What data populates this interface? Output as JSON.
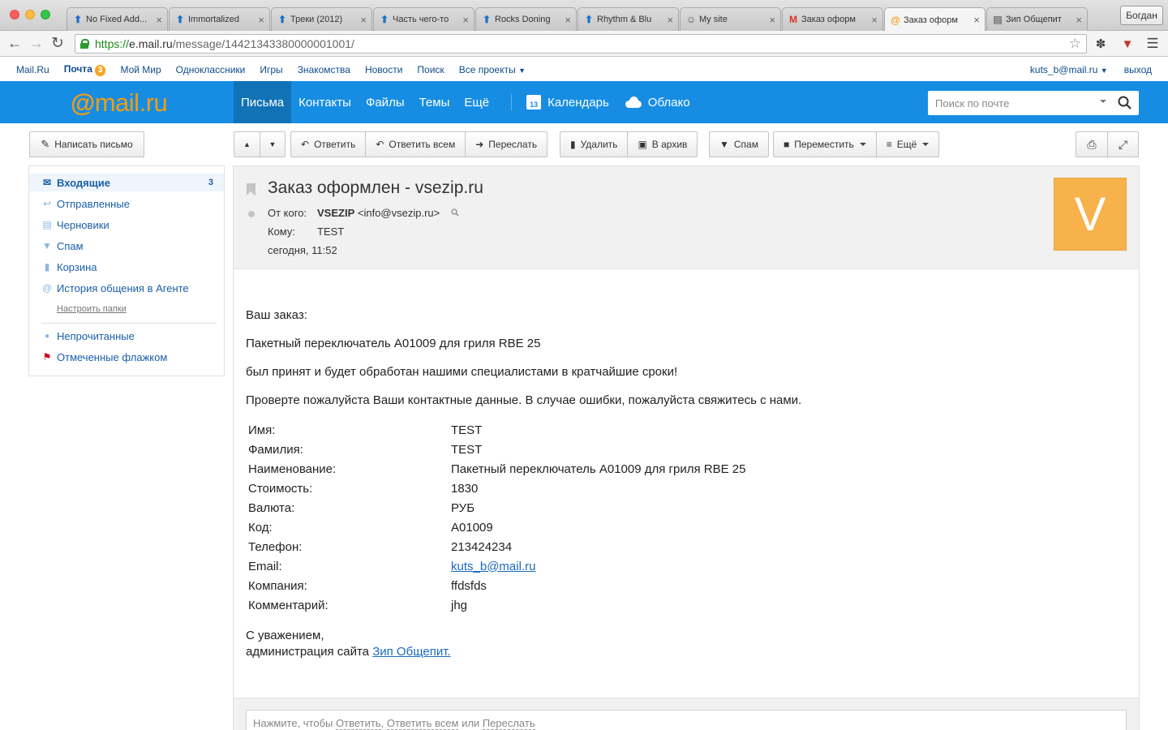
{
  "browser": {
    "tabs": [
      {
        "title": "No Fixed Add...",
        "favicon": "arrow-up-icon",
        "active": false
      },
      {
        "title": "Immortalized",
        "favicon": "arrow-up-icon",
        "active": false
      },
      {
        "title": "Треки (2012)",
        "favicon": "arrow-up-icon",
        "active": false
      },
      {
        "title": "Часть чего-то",
        "favicon": "arrow-up-icon",
        "active": false
      },
      {
        "title": "Rocks Doning",
        "favicon": "arrow-up-icon",
        "active": false
      },
      {
        "title": "Rhythm & Blu",
        "favicon": "arrow-up-icon",
        "active": false
      },
      {
        "title": "My site",
        "favicon": "ghost-icon",
        "active": false
      },
      {
        "title": "Заказ оформ",
        "favicon": "gmail-icon",
        "active": false
      },
      {
        "title": "Заказ оформ",
        "favicon": "mailru-icon",
        "active": true
      },
      {
        "title": "Зип Общепит",
        "favicon": "page-icon",
        "active": false
      }
    ],
    "profile_name": "Богдан",
    "url_scheme": "https://",
    "url_host": "e.mail.ru",
    "url_path": "/message/14421343380000001001/"
  },
  "portal": {
    "links": [
      "Mail.Ru",
      "Почта",
      "Мой Мир",
      "Одноклассники",
      "Игры",
      "Знакомства",
      "Новости",
      "Поиск",
      "Все проекты"
    ],
    "mail_badge": "3",
    "user_email": "kuts_b@mail.ru",
    "logout": "выход"
  },
  "header": {
    "logo_at": "@",
    "logo_text": "mail",
    "logo_tld": ".ru",
    "nav": [
      "Письма",
      "Контакты",
      "Файлы",
      "Темы",
      "Ещё"
    ],
    "calendar": "Календарь",
    "calendar_day": "13",
    "cloud": "Облако",
    "search_placeholder": "Поиск по почте"
  },
  "sidebar": {
    "compose": "Написать письмо",
    "folders": [
      {
        "label": "Входящие",
        "count": "3",
        "icon": "envelope-icon"
      },
      {
        "label": "Отправленные",
        "icon": "reply-icon"
      },
      {
        "label": "Черновики",
        "icon": "draft-icon"
      },
      {
        "label": "Спам",
        "icon": "thumbs-down-icon"
      },
      {
        "label": "Корзина",
        "icon": "trash-icon"
      },
      {
        "label": "История общения в Агенте",
        "icon": "agent-icon"
      }
    ],
    "setup_folders": "Настроить папки",
    "filters": [
      {
        "label": "Непрочитанные",
        "icon": "dot-icon"
      },
      {
        "label": "Отмеченные флажком",
        "icon": "flag-icon"
      }
    ]
  },
  "toolbar": {
    "reply": "Ответить",
    "reply_all": "Ответить всем",
    "forward": "Переслать",
    "delete": "Удалить",
    "archive": "В архив",
    "spam": "Спам",
    "move": "Переместить",
    "more": "Ещё"
  },
  "message": {
    "subject": "Заказ оформлен - vsezip.ru",
    "from_label": "От кого:",
    "from_name": "VSEZIP",
    "from_email": "<info@vsezip.ru>",
    "to_label": "Кому:",
    "to_value": "TEST",
    "date": "сегодня, 11:52",
    "avatar_letter": "V",
    "avatar_color": "#f8b24c",
    "intro": "Ваш заказ:",
    "item": "Пакетный переключатель A01009 для гриля RBE 25",
    "accepted": "был принят и будет обработан нашими специалистами в кратчайшие сроки!",
    "check": "Проверте пожалуйста Ваши контактные данные. В случае ошибки, пожалуйста свяжитесь с нами.",
    "fields": [
      {
        "key": "Имя:",
        "value": "TEST"
      },
      {
        "key": "Фамилия:",
        "value": "TEST"
      },
      {
        "key": "Наименование:",
        "value": "Пакетный переключатель A01009 для гриля RBE 25"
      },
      {
        "key": "Стоимость:",
        "value": "1830"
      },
      {
        "key": "Валюта:",
        "value": "РУБ"
      },
      {
        "key": "Код:",
        "value": "A01009"
      },
      {
        "key": "Телефон:",
        "value": "213424234"
      },
      {
        "key": "Email:",
        "value": "kuts_b@mail.ru"
      },
      {
        "key": "Компания:",
        "value": "ffdsfds"
      },
      {
        "key": "Комментарий:",
        "value": "jhg"
      }
    ],
    "regards": "С уважением,",
    "admin": "администрация сайта",
    "site_link": "Зип Общепит."
  },
  "reply_bar": {
    "prefix": "Нажмите, чтобы",
    "reply": "Ответить",
    "sep": ",",
    "reply_all": "Ответить всем",
    "or": "или",
    "forward": "Переслать"
  },
  "colors": {
    "accent": "#168de2",
    "brand_orange": "#f39c12"
  }
}
